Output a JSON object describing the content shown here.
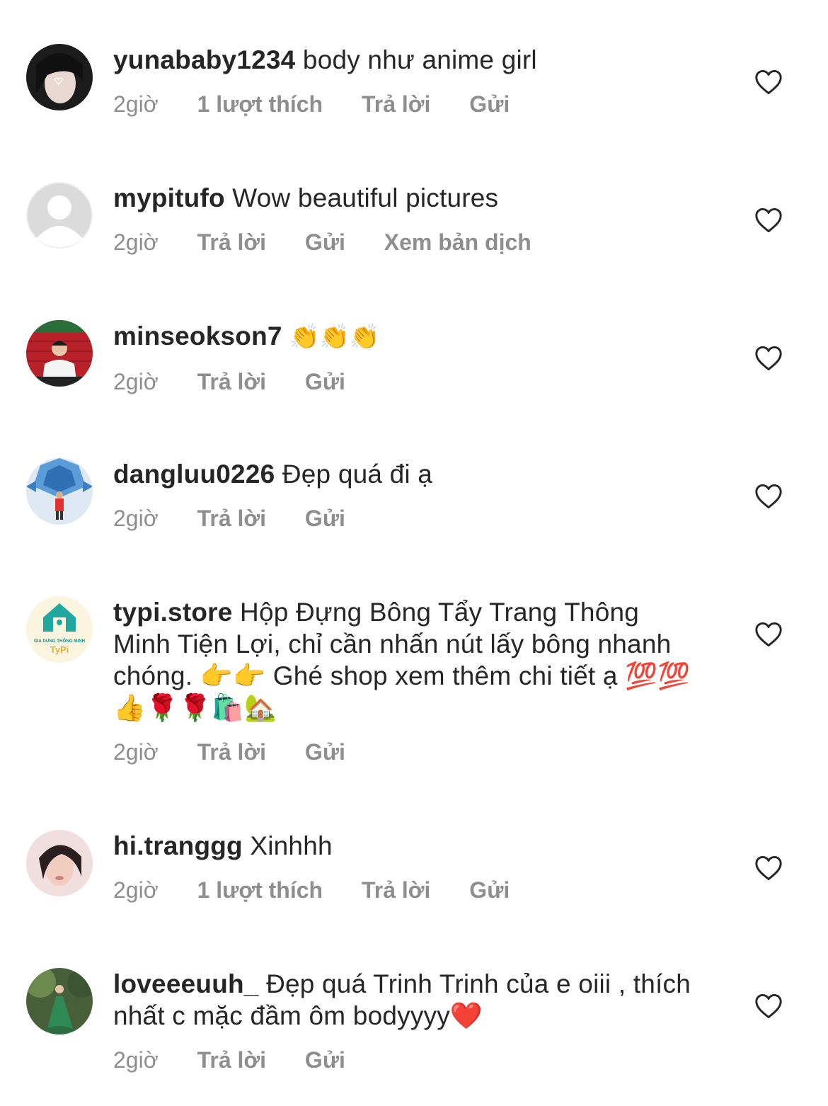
{
  "colors": {
    "text": "#262626",
    "secondary": "#8e8e8e",
    "heart_stroke": "#262626"
  },
  "comments": [
    {
      "username": "yunababy1234",
      "text": "body như anime girl",
      "time": "2giờ",
      "likes": "1 lượt thích",
      "reply": "Trả lời",
      "send": "Gửi",
      "avatar": "avatar-dark-hair-girl",
      "like_icon": "heart-outline-icon"
    },
    {
      "username": "mypitufo",
      "text": "Wow beautiful pictures",
      "time": "2giờ",
      "reply": "Trả lời",
      "send": "Gửi",
      "translate": "Xem bản dịch",
      "avatar": "avatar-default-placeholder",
      "like_icon": "heart-outline-icon"
    },
    {
      "username": "minseokson7",
      "text": "👏👏👏",
      "time": "2giờ",
      "reply": "Trả lời",
      "send": "Gửi",
      "avatar": "avatar-man-red-brick-wall",
      "like_icon": "heart-outline-icon"
    },
    {
      "username": "dangluu0226",
      "text": "Đẹp quá đi ạ",
      "time": "2giờ",
      "reply": "Trả lời",
      "send": "Gửi",
      "avatar": "avatar-blue-geometric-person",
      "like_icon": "heart-outline-icon"
    },
    {
      "username": "typi.store",
      "text": "Hộp Đựng Bông Tẩy Trang Thông Minh Tiện Lợi, chỉ cần nhấn nút lấy bông nhanh chóng. 👉👉 Ghé shop xem thêm chi tiết ạ 💯💯👍🌹🌹🛍️🏡",
      "time": "2giờ",
      "reply": "Trả lời",
      "send": "Gửi",
      "avatar": "avatar-typi-logo",
      "avatar_caption": "GIA DỤNG THÔNG MINH",
      "avatar_brand": "TyPi",
      "like_icon": "heart-outline-icon"
    },
    {
      "username": "hi.tranggg",
      "text": "Xinhhh",
      "time": "2giờ",
      "likes": "1 lượt thích",
      "reply": "Trả lời",
      "send": "Gửi",
      "avatar": "avatar-girl-portrait",
      "like_icon": "heart-outline-icon"
    },
    {
      "username": "loveeeuuh_",
      "text": "Đẹp quá Trinh Trinh của e oiii , thích nhất c mặc đầm ôm bodyyyy❤️",
      "time": "2giờ",
      "reply": "Trả lời",
      "send": "Gửi",
      "avatar": "avatar-green-dress-forest",
      "like_icon": "heart-outline-icon"
    }
  ]
}
